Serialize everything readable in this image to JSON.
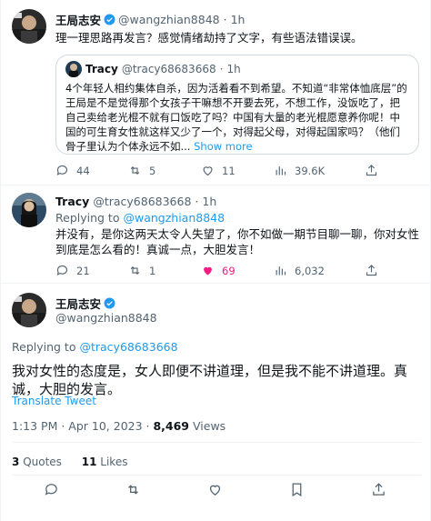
{
  "tweet1": {
    "name": "王局志安",
    "handle": "@wangzhian8848",
    "sep": "·",
    "time": "1h",
    "text": "理一理思路再发言？感觉情绪劫持了文字，有些语法错误误。",
    "quote": {
      "name": "Tracy",
      "handle": "@tracy68683668",
      "sep": "·",
      "time": "1h",
      "text": "4个年轻人相约集体自杀，因为活着看不到希望。不知道“非常体恤底层”的王局是不是觉得那个女孩子干嘛想不开要去死，不想工作，没饭吃了，把自己卖给老光棍不就有口饭吃了吗？中国有大量的老光棍愿意养你呢！中国的可生育女性就这样又少了一个，对得起父母，对得起国家吗？（他们骨子里认为个体永远不如...",
      "show_more": "Show more"
    },
    "stats": {
      "replies": "44",
      "retweets": "5",
      "likes": "11",
      "views": "39.6K"
    }
  },
  "tweet2": {
    "name": "Tracy",
    "handle": "@tracy68683668",
    "sep": "·",
    "time": "1h",
    "replying_prefix": "Replying to",
    "replying_to": "@wangzhian8848",
    "text": "并没有，是你这两天太令人失望了，你不如做一期节目聊一聊，你对女性到底是怎么看的！真诚一点，大胆发言！",
    "stats": {
      "replies": "21",
      "retweets": "1",
      "likes": "69",
      "views": "6,032"
    }
  },
  "tweet3": {
    "name": "王局志安",
    "handle": "@wangzhian8848",
    "replying_prefix": "Replying to",
    "replying_to": "@tracy68683668",
    "text": "我对女性的态度是，女人即便不讲道理，但是我不能不讲道理。真诚，大胆的发言。",
    "translate": "Translate Tweet",
    "timestamp": "1:13 PM · Apr 10, 2023 · ",
    "views_count": "8,469",
    "views_label": "Views",
    "quotes_count": "3",
    "quotes_label": "Quotes",
    "likes_count": "11",
    "likes_label": "Likes"
  },
  "icons": [
    "verified-badge-icon",
    "reply-icon",
    "retweet-icon",
    "like-icon",
    "views-icon",
    "share-icon",
    "bookmark-icon"
  ],
  "colors": {
    "accent": "#1d9bf0",
    "like": "#f91880",
    "muted": "#536471",
    "border": "#cfd9de"
  }
}
